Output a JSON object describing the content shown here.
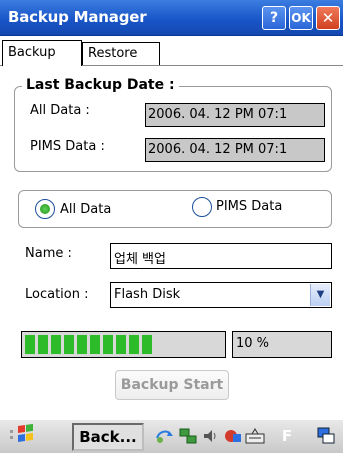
{
  "window": {
    "title": "Backup Manager",
    "help_label": "?",
    "ok_label": "OK",
    "close_label": "✕"
  },
  "tabs": [
    {
      "label": "Backup",
      "active": true
    },
    {
      "label": "Restore",
      "active": false
    }
  ],
  "last_backup": {
    "title": "Last Backup Date :",
    "all_label": "All Data :",
    "all_value": "2006. 04. 12 PM 07:1",
    "pims_label": "PIMS Data :",
    "pims_value": "2006. 04. 12 PM 07:1"
  },
  "scope": {
    "options": [
      "All Data",
      "PIMS Data"
    ],
    "selected": "All Data"
  },
  "name": {
    "label": "Name :",
    "value": "업체 백업"
  },
  "location": {
    "label": "Location :",
    "value": "Flash Disk"
  },
  "progress": {
    "value": 0.1,
    "percent_label": "10 %"
  },
  "start_button": "Backup Start",
  "taskbar": {
    "task_label": "Back...",
    "tray_letter": "F"
  },
  "colors": {
    "title_bar": "#1a56c8",
    "progress_fill": "#2dbb2a"
  }
}
